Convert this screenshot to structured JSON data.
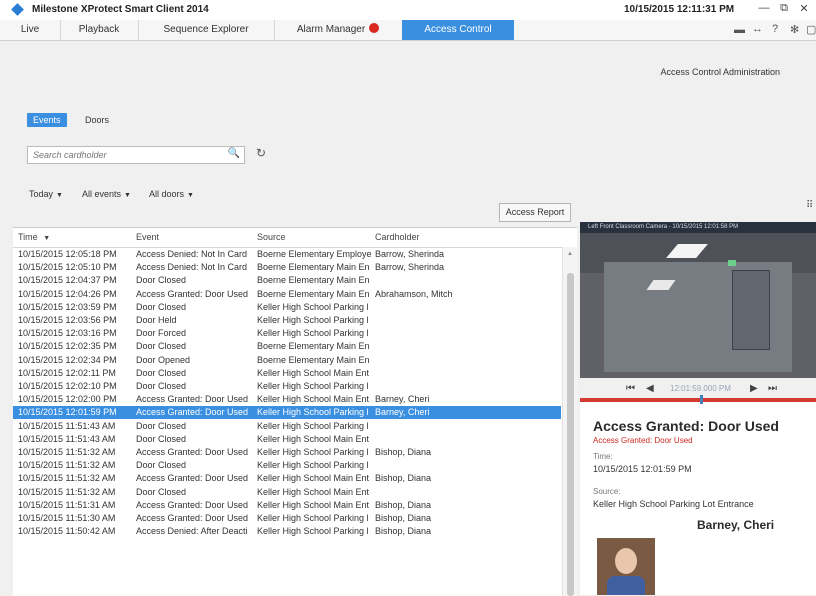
{
  "app": {
    "title": "Milestone XProtect Smart Client 2014",
    "datetime": "10/15/2015 12:11:31 PM",
    "window_controls": {
      "minimize": "—",
      "restore": "⧉",
      "close": "✕"
    }
  },
  "tabs": [
    {
      "label": "Live"
    },
    {
      "label": "Playback"
    },
    {
      "label": "Sequence Explorer"
    },
    {
      "label": "Alarm Manager"
    },
    {
      "label": "Access Control"
    }
  ],
  "toolbar_icons": {
    "pin": "▬",
    "link": "↔",
    "help": "?",
    "settings": "✻",
    "more": "▢"
  },
  "admin_link": "Access Control Administration",
  "mode_buttons": {
    "events": "Events",
    "doors": "Doors"
  },
  "search": {
    "placeholder": "Search cardholder",
    "search_glyph": "🔍",
    "refresh_glyph": "↻"
  },
  "filters": {
    "date": "Today",
    "events": "All events",
    "doors": "All doors"
  },
  "report_button": "Access Report",
  "table": {
    "headers": {
      "time": "Time",
      "event": "Event",
      "source": "Source",
      "cardholder": "Cardholder"
    },
    "rows": [
      {
        "time": "10/15/2015 12:05:18 PM",
        "event": "Access Denied: Not In Card",
        "source": "Boerne Elementary Employe",
        "cardholder": "Barrow, Sherinda"
      },
      {
        "time": "10/15/2015 12:05:10 PM",
        "event": "Access Denied: Not In Card",
        "source": "Boerne Elementary Main En",
        "cardholder": "Barrow, Sherinda"
      },
      {
        "time": "10/15/2015 12:04:37 PM",
        "event": "Door Closed",
        "source": "Boerne Elementary Main En",
        "cardholder": ""
      },
      {
        "time": "10/15/2015 12:04:26 PM",
        "event": "Access Granted: Door Used",
        "source": "Boerne Elementary Main En",
        "cardholder": "Abrahamson, Mitch"
      },
      {
        "time": "10/15/2015 12:03:59 PM",
        "event": "Door Closed",
        "source": "Keller High School Parking l",
        "cardholder": ""
      },
      {
        "time": "10/15/2015 12:03:56 PM",
        "event": "Door Held",
        "source": "Keller High School Parking l",
        "cardholder": ""
      },
      {
        "time": "10/15/2015 12:03:16 PM",
        "event": "Door Forced",
        "source": "Keller High School Parking l",
        "cardholder": ""
      },
      {
        "time": "10/15/2015 12:02:35 PM",
        "event": "Door Closed",
        "source": "Boerne Elementary Main En",
        "cardholder": ""
      },
      {
        "time": "10/15/2015 12:02:34 PM",
        "event": "Door Opened",
        "source": "Boerne Elementary Main En",
        "cardholder": ""
      },
      {
        "time": "10/15/2015 12:02:11 PM",
        "event": "Door Closed",
        "source": "Keller High School Main Ent",
        "cardholder": ""
      },
      {
        "time": "10/15/2015 12:02:10 PM",
        "event": "Door Closed",
        "source": "Keller High School Parking l",
        "cardholder": ""
      },
      {
        "time": "10/15/2015 12:02:00 PM",
        "event": "Access Granted: Door Used",
        "source": "Keller High School Main Ent",
        "cardholder": "Barney, Cheri"
      },
      {
        "time": "10/15/2015 12:01:59 PM",
        "event": "Access Granted: Door Used",
        "source": "Keller High School Parking l",
        "cardholder": "Barney, Cheri"
      },
      {
        "time": "10/15/2015 11:51:43 AM",
        "event": "Door Closed",
        "source": "Keller High School Parking l",
        "cardholder": ""
      },
      {
        "time": "10/15/2015 11:51:43 AM",
        "event": "Door Closed",
        "source": "Keller High School Main Ent",
        "cardholder": ""
      },
      {
        "time": "10/15/2015 11:51:32 AM",
        "event": "Access Granted: Door Used",
        "source": "Keller High School Parking l",
        "cardholder": "Bishop, Diana"
      },
      {
        "time": "10/15/2015 11:51:32 AM",
        "event": "Door Closed",
        "source": "Keller High School Parking l",
        "cardholder": ""
      },
      {
        "time": "10/15/2015 11:51:32 AM",
        "event": "Access Granted: Door Used",
        "source": "Keller High School Main Ent",
        "cardholder": "Bishop, Diana"
      },
      {
        "time": "10/15/2015 11:51:32 AM",
        "event": "Door Closed",
        "source": "Keller High School Main Ent",
        "cardholder": ""
      },
      {
        "time": "10/15/2015 11:51:31 AM",
        "event": "Access Granted: Door Used",
        "source": "Keller High School Main Ent",
        "cardholder": "Bishop, Diana"
      },
      {
        "time": "10/15/2015 11:51:30 AM",
        "event": "Access Granted: Door Used",
        "source": "Keller High School Parking l",
        "cardholder": "Bishop, Diana"
      },
      {
        "time": "10/15/2015 11:50:42 AM",
        "event": "Access Denied: After Deacti",
        "source": "Keller High School Parking l",
        "cardholder": "Bishop, Diana"
      }
    ],
    "selected_index": 12
  },
  "camera": {
    "title": "Left Front Classroom Camera - 10/15/2015 12:01:58 PM",
    "playback_time": "12:01:59.000 PM",
    "controls": {
      "skip_back": "⏮",
      "back": "◀",
      "forward": "▶",
      "skip_forward": "⏭"
    }
  },
  "details": {
    "title": "Access Granted: Door Used",
    "subtitle": "Access Granted: Door Used",
    "time_label": "Time:",
    "time_value": "10/15/2015 12:01:59 PM",
    "source_label": "Source:",
    "source_value": "Keller High School Parking Lot Entrance",
    "cardholder_name": "Barney, Cheri"
  }
}
